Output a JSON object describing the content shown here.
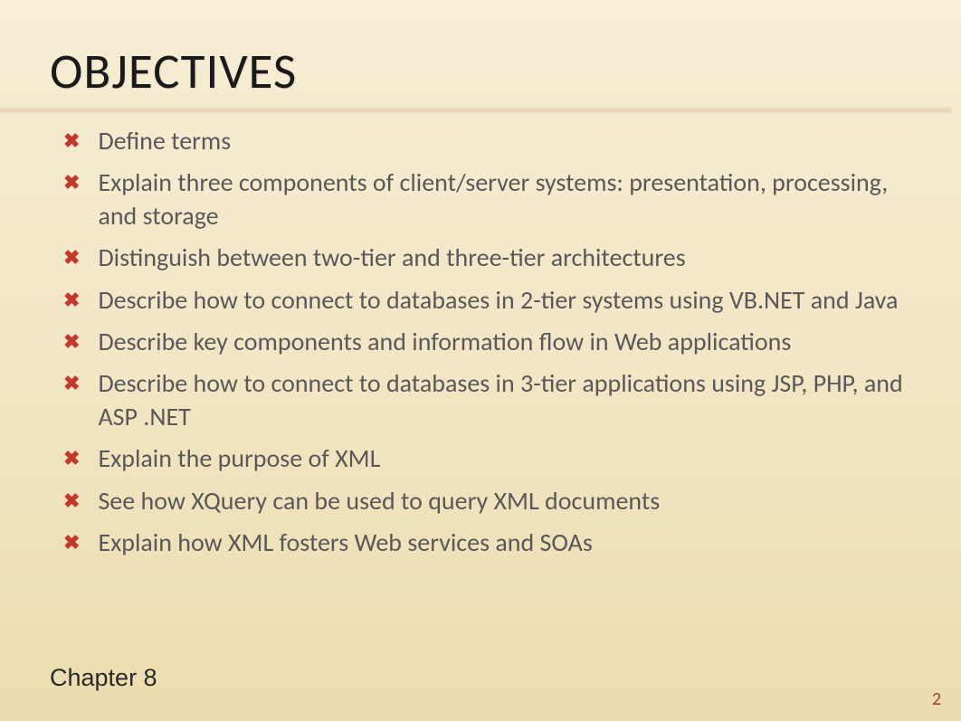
{
  "title": "OBJECTIVES",
  "bullets": [
    "Define terms",
    "Explain three components of client/server systems: presentation, processing, and storage",
    "Distinguish between two-tier and three-tier architectures",
    "Describe how to connect to databases in 2-tier systems using VB.NET and Java",
    "Describe key components and information flow in Web applications",
    "Describe how to connect to databases in 3-tier applications using JSP, PHP, and ASP .NET",
    "Explain the purpose of XML",
    "See how XQuery can be used to query XML documents",
    "Explain how XML fosters Web services and SOAs"
  ],
  "chapter": "Chapter 8",
  "page_number": "2",
  "bullet_glyph": "✖"
}
